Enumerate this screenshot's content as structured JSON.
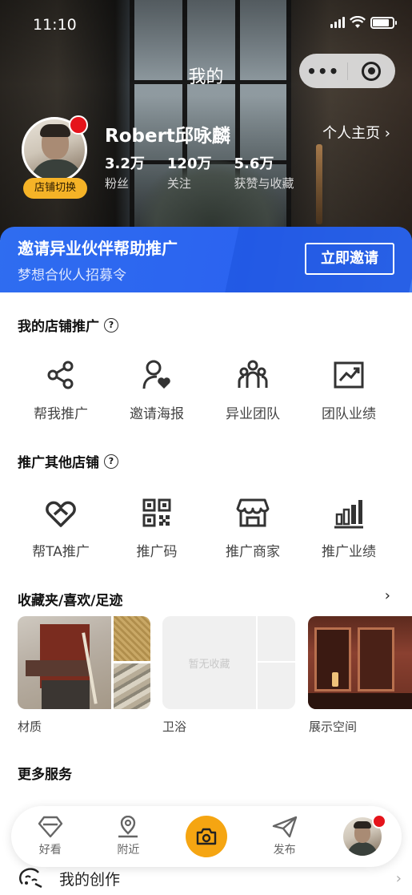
{
  "status_bar": {
    "time": "11:10"
  },
  "nav": {
    "title": "我的",
    "more_label": "•••"
  },
  "profile": {
    "username": "Robert邱咏麟",
    "store_switch": "店铺切换",
    "homepage_link": "个人主页 ›",
    "stats": [
      {
        "value": "3.2万",
        "label": "粉丝"
      },
      {
        "value": "120万",
        "label": "关注"
      },
      {
        "value": "5.6万",
        "label": "获赞与收藏"
      }
    ]
  },
  "invite": {
    "title": "邀请异业伙伴帮助推广",
    "subtitle": "梦想合伙人招募令",
    "button": "立即邀请"
  },
  "my_store": {
    "title": "我的店铺推广",
    "help": "?",
    "items": [
      {
        "label": "帮我推广",
        "icon": "share-icon"
      },
      {
        "label": "邀请海报",
        "icon": "user-heart-icon"
      },
      {
        "label": "异业团队",
        "icon": "team-icon"
      },
      {
        "label": "团队业绩",
        "icon": "chart-trend-icon"
      }
    ]
  },
  "other_store": {
    "title": "推广其他店铺",
    "help": "?",
    "items": [
      {
        "label": "帮TA推广",
        "icon": "heart-link-icon"
      },
      {
        "label": "推广码",
        "icon": "qrcode-icon"
      },
      {
        "label": "推广商家",
        "icon": "store-icon"
      },
      {
        "label": "推广业绩",
        "icon": "bar-chart-icon"
      }
    ]
  },
  "favorites": {
    "title": "收藏夹/喜欢/足迹",
    "arrow": "›",
    "items": [
      {
        "label": "材质"
      },
      {
        "label": "卫浴",
        "empty_text": "暂无收藏"
      },
      {
        "label": "展示空间"
      }
    ]
  },
  "more_services": {
    "title": "更多服务"
  },
  "tabbar": {
    "items": [
      {
        "label": "好看",
        "icon": "diamond-icon"
      },
      {
        "label": "附近",
        "icon": "location-pin-icon"
      },
      {
        "label": "",
        "icon": "camera-icon"
      },
      {
        "label": "发布",
        "icon": "paper-plane-icon"
      },
      {
        "label": "",
        "icon": "avatar"
      }
    ]
  },
  "creation": {
    "label": "我的创作",
    "arrow": "›"
  },
  "colors": {
    "accent_blue": "#2f6df0",
    "badge_orange": "#f5b327",
    "camera_orange": "#f5a512",
    "notify_red": "#e5141b"
  }
}
